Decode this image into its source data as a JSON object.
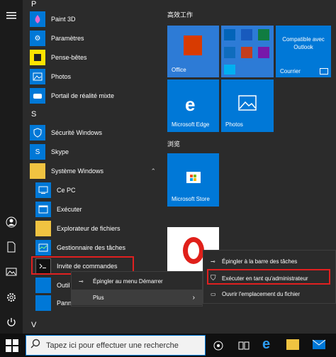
{
  "applist": {
    "letter_p": "P",
    "letter_s": "S",
    "letter_v": "V",
    "items": [
      {
        "label": "Paint 3D"
      },
      {
        "label": "Paramètres"
      },
      {
        "label": "Pense-bêtes"
      },
      {
        "label": "Photos"
      },
      {
        "label": "Portail de réalité mixte"
      },
      {
        "label": "Sécurité Windows"
      },
      {
        "label": "Skype"
      },
      {
        "label": "Système Windows"
      },
      {
        "label": "Ce PC"
      },
      {
        "label": "Exécuter"
      },
      {
        "label": "Explorateur de fichiers"
      },
      {
        "label": "Gestionnaire des tâches"
      },
      {
        "label": "Invite de commandes"
      },
      {
        "label": "Outil"
      },
      {
        "label": "Pann"
      }
    ]
  },
  "tiles": {
    "group1": "高效工作",
    "group2": "浏览",
    "office": "Office",
    "outlook": "Compatible avec Outlook",
    "outlook2": "Courrier",
    "edge": "Microsoft Edge",
    "photos": "Photos",
    "store": "Microsoft Store"
  },
  "context_menu": {
    "pin_start": "Épingler au menu Démarrer",
    "more": "Plus"
  },
  "submenu": {
    "pin_taskbar": "Épingler à la barre des tâches",
    "run_admin": "Exécuter en tant qu'administrateur",
    "open_location": "Ouvrir l'emplacement du fichier"
  },
  "taskbar": {
    "search_placeholder": "Tapez ici pour effectuer une recherche"
  },
  "colors": {
    "accent": "#0078d7",
    "highlight": "#e02020"
  }
}
